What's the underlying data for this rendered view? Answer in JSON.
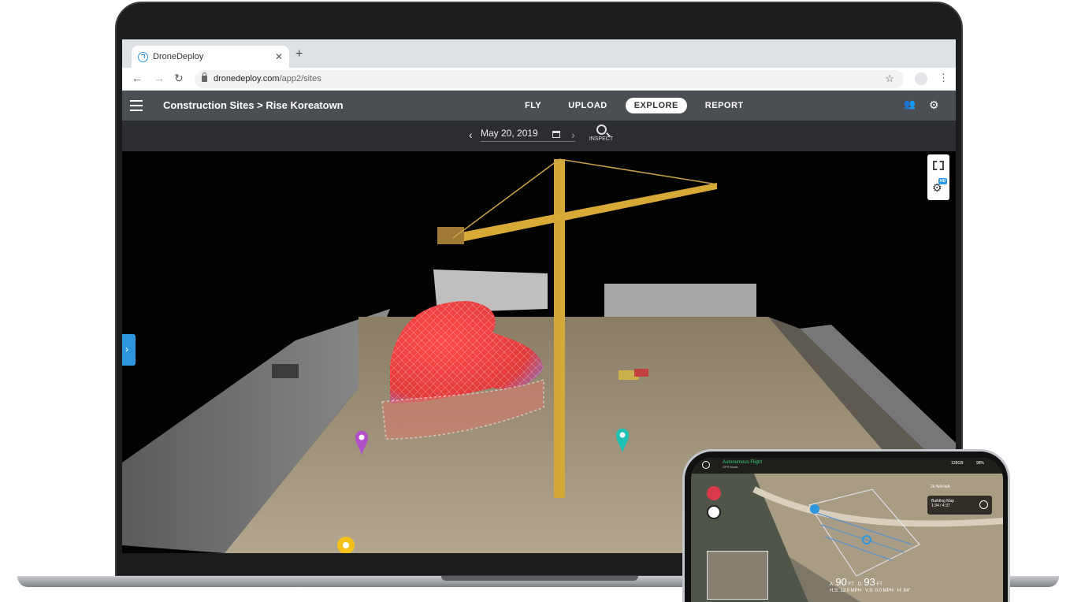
{
  "browser": {
    "tab_title": "DroneDeploy",
    "tab_close": "✕",
    "new_tab": "+",
    "url_host": "dronedeploy.com",
    "url_path": "/app2/sites",
    "back_glyph": "←",
    "forward_glyph": "→",
    "reload_glyph": "↻",
    "star_glyph": "☆",
    "menu_glyph": "⋮"
  },
  "app": {
    "breadcrumb": "Construction Sites > Rise Koreatown",
    "tabs": [
      {
        "label": "FLY"
      },
      {
        "label": "UPLOAD"
      },
      {
        "label": "EXPLORE",
        "active": true
      },
      {
        "label": "REPORT"
      }
    ],
    "add_user_glyph": "👥",
    "settings_glyph": "⚙",
    "date": "May 20, 2019",
    "prev_glyph": "‹",
    "next_glyph": "›",
    "inspect_label": "INSPECT",
    "sidebar_toggle_glyph": "›",
    "hd_badge": "HD",
    "gear_glyph": "⚙"
  },
  "phone": {
    "flight_status": "Autonomous Flight",
    "flight_mode": "GPS Mode",
    "storage": "128GB",
    "battery": "98%",
    "mission_title": "Building Map",
    "mission_time": "1:34 / 4:37",
    "counts": "26   N/A   N/A",
    "altitude_label": "A:",
    "altitude_value": "90",
    "altitude_unit": "FT",
    "distance_label": "D:",
    "distance_value": "93",
    "distance_unit": "FT",
    "hspeed": "H.S: 12.0 MPH",
    "vspeed": "V.S: 0.0 MPH",
    "heading": "H: 84°"
  },
  "colors": {
    "accent": "#2c97de",
    "header_bg": "#4b4e53",
    "datebar_bg": "#2b2d31",
    "marker_purple": "#b04fc9",
    "marker_teal": "#1fc1b4",
    "marker_yellow": "#f4c21a",
    "volume_red": "#e23b3b",
    "flight_green": "#35d07f"
  }
}
